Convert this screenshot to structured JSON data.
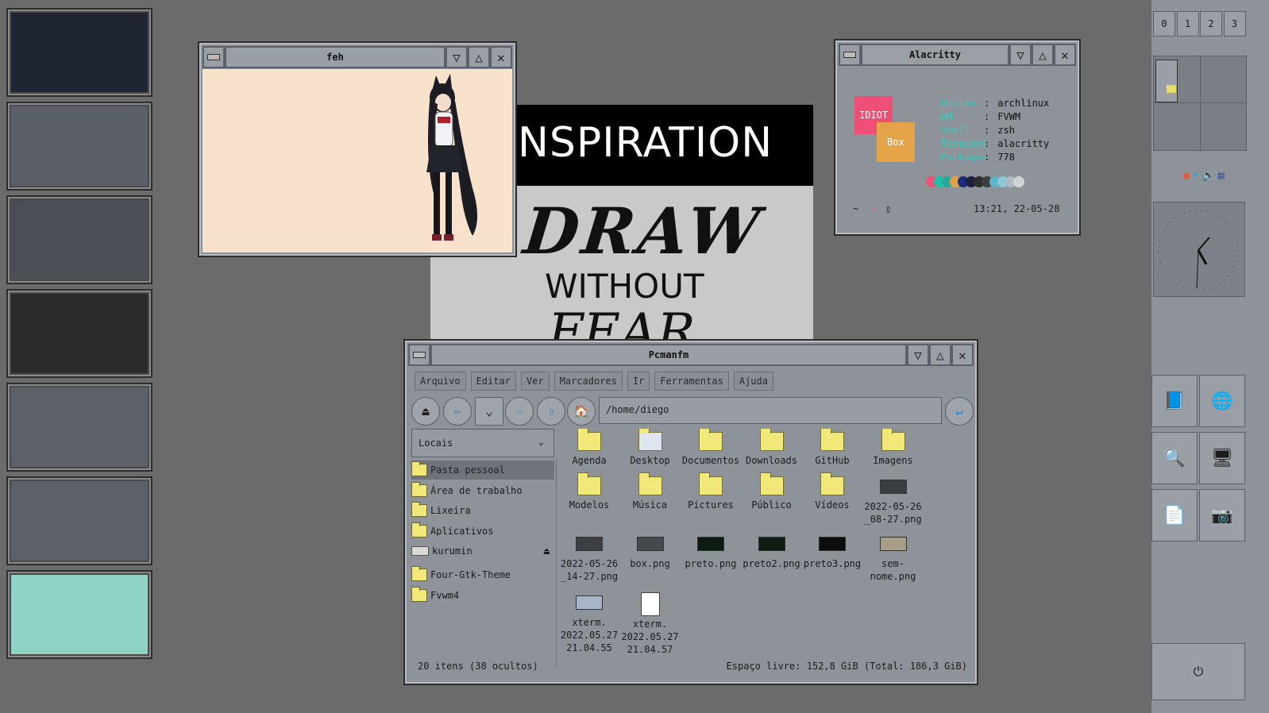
{
  "thumbnails": [
    {
      "name": "thumb-1",
      "bg": "#1f2532"
    },
    {
      "name": "thumb-2",
      "bg": "#5b6068"
    },
    {
      "name": "thumb-3",
      "bg": "#4b4f55"
    },
    {
      "name": "thumb-4",
      "bg": "#2a2a2a"
    },
    {
      "name": "thumb-5",
      "bg": "#5c6068"
    },
    {
      "name": "thumb-6",
      "bg": "#5c6068"
    },
    {
      "name": "thumb-7",
      "bg": "#8fd3c4"
    }
  ],
  "poster": {
    "line1": "NSPIRATION",
    "line2": "DRAW",
    "line3": "WITHOUT",
    "line4": "FEAR"
  },
  "feh": {
    "title": "feh"
  },
  "alacritty": {
    "title": "Alacritty",
    "logo_top": "IDIOT",
    "logo_bottom": "Box",
    "rows": [
      {
        "key": "Distro",
        "sep": ":",
        "value": "archlinux"
      },
      {
        "key": "WM",
        "sep": ":",
        "value": "FVWM"
      },
      {
        "key": "Shell",
        "sep": ":",
        "value": "zsh"
      },
      {
        "key": "Terminal",
        "sep": ":",
        "value": "alacritty"
      },
      {
        "key": "Packages",
        "sep": ":",
        "value": "778"
      }
    ],
    "palette": [
      "#f0527a",
      "#1ec0a8",
      "#2aa89a",
      "#e2a047",
      "#1a2a7a",
      "#1c2040",
      "#2e2e2e",
      "#3f3f3f",
      "#5ab6c8",
      "#8cc8d6",
      "#b0b8c0",
      "#cfd3d6"
    ],
    "prompt": "~",
    "cursor": "▯",
    "datetime": "13:21, 22-05-28"
  },
  "pcmanfm": {
    "title": "Pcmanfm",
    "menu": [
      "Arquivo",
      "Editar",
      "Ver",
      "Marcadores",
      "Ir",
      "Ferramentas",
      "Ajuda"
    ],
    "path": "/home/diego",
    "places_label": "Locais",
    "places": [
      {
        "label": "Pasta pessoal",
        "selected": true
      },
      {
        "label": "Área de trabalho",
        "selected": false
      },
      {
        "label": "Lixeira",
        "selected": false
      },
      {
        "label": "Aplicativos",
        "selected": false
      },
      {
        "label": "kurumin",
        "selected": false
      }
    ],
    "bookmarks": [
      "Four-Gtk-Theme",
      "Fvwm4"
    ],
    "files": [
      {
        "label": "Agenda",
        "type": "folder"
      },
      {
        "label": "Desktop",
        "type": "desktop"
      },
      {
        "label": "Documentos",
        "type": "folder"
      },
      {
        "label": "Downloads",
        "type": "folder"
      },
      {
        "label": "GitHub",
        "type": "folder"
      },
      {
        "label": "Imagens",
        "type": "folder"
      },
      {
        "label": "Modelos",
        "type": "folder"
      },
      {
        "label": "Música",
        "type": "folder"
      },
      {
        "label": "Pictures",
        "type": "folder"
      },
      {
        "label": "Público",
        "type": "folder"
      },
      {
        "label": "Vídeos",
        "type": "folder"
      },
      {
        "label": "2022-05-26\n_08-27.png",
        "type": "image",
        "color": "#3a3d42"
      },
      {
        "label": "2022-05-26\n_14-27.png",
        "type": "image",
        "color": "#3c3f44"
      },
      {
        "label": "box.png",
        "type": "image",
        "color": "#45484d"
      },
      {
        "label": "preto.png",
        "type": "image",
        "color": "#0d1a10"
      },
      {
        "label": "preto2.png",
        "type": "image",
        "color": "#101d12"
      },
      {
        "label": "preto3.png",
        "type": "image",
        "color": "#0c0c0c"
      },
      {
        "label": "sem-\nnome.png",
        "type": "image",
        "color": "#a89e88"
      },
      {
        "label": "xterm.\n2022.05.27\n21.04.55",
        "type": "image",
        "color": "#a8b4c8"
      },
      {
        "label": "xterm.\n2022.05.27\n21.04.57",
        "type": "doc"
      }
    ],
    "status_left": "20 itens (38 ocultos)",
    "status_right": "Espaço livre: 152,8 GiB (Total: 186,3 GiB)"
  },
  "panel": {
    "desks": [
      "0",
      "1",
      "2",
      "3"
    ],
    "tray_icons": [
      "firefox-icon",
      "telegram-icon",
      "volume-icon",
      "network-icon"
    ],
    "launchers": [
      "notes-icon",
      "web-browser-icon",
      "file-search-icon",
      "terminal-icon",
      "file-manager-icon",
      "screenshot-icon"
    ],
    "power": "⏻"
  }
}
